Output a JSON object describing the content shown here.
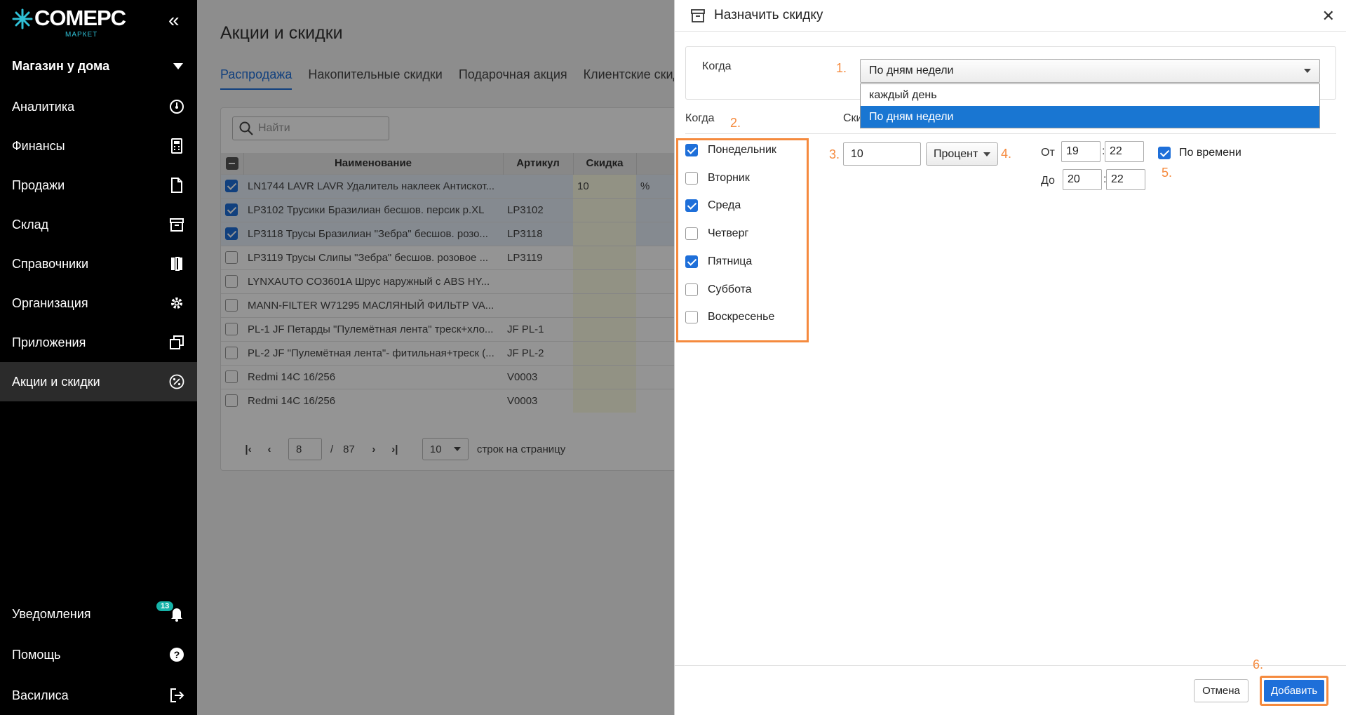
{
  "sidebar": {
    "logo_text": "COMEPC",
    "logo_sub": "МАРКЕТ",
    "store": "Магазин у дома",
    "items": [
      {
        "label": "Аналитика",
        "icon": "gauge-icon"
      },
      {
        "label": "Финансы",
        "icon": "calculator-icon"
      },
      {
        "label": "Продажи",
        "icon": "document-icon"
      },
      {
        "label": "Склад",
        "icon": "box-icon"
      },
      {
        "label": "Справочники",
        "icon": "books-icon"
      },
      {
        "label": "Организация",
        "icon": "gear-icon"
      },
      {
        "label": "Приложения",
        "icon": "windows-icon"
      },
      {
        "label": "Акции и скидки",
        "icon": "percent-icon"
      }
    ],
    "bottom": [
      {
        "label": "Уведомления",
        "icon": "bell-icon"
      },
      {
        "label": "Помощь",
        "icon": "help-icon"
      },
      {
        "label": "Василиса",
        "icon": "logout-icon"
      }
    ],
    "badge": "13"
  },
  "main": {
    "title": "Акции и скидки",
    "tabs": [
      "Распродажа",
      "Накопительные скидки",
      "Подарочная акция",
      "Клиентские скидки"
    ],
    "search_placeholder": "Найти",
    "columns": [
      "Наименование",
      "Артикул",
      "Скидка"
    ],
    "rows": [
      {
        "name": "LN1744 LAVR LAVR Удалитель наклеек Антискот...",
        "sku": "",
        "discount": "10",
        "unit": "%",
        "checked": true
      },
      {
        "name": "LP3102 Трусики Бразилиан бесшов. персик р.XL",
        "sku": "LP3102",
        "discount": "",
        "unit": "",
        "checked": true
      },
      {
        "name": "LP3118 Трусы Бразилиан \"Зебра\" бесшов. розо...",
        "sku": "LP3118",
        "discount": "",
        "unit": "",
        "checked": true
      },
      {
        "name": "LP3119 Трусы Слипы \"Зебра\" бесшов. розовое ...",
        "sku": "LP3119",
        "discount": "",
        "unit": "",
        "checked": false
      },
      {
        "name": "LYNXAUTO CO3601A Шрус наружный с ABS HY...",
        "sku": "",
        "discount": "",
        "unit": "",
        "checked": false
      },
      {
        "name": "MANN-FILTER W71295 МАСЛЯНЫЙ ФИЛЬТР VA...",
        "sku": "",
        "discount": "",
        "unit": "",
        "checked": false
      },
      {
        "name": "PL-1 JF Петарды \"Пулемётная лента\" треск+хло...",
        "sku": "JF PL-1",
        "discount": "",
        "unit": "",
        "checked": false
      },
      {
        "name": "PL-2 JF \"Пулемётная лента\"- фитильная+треск (...",
        "sku": "JF PL-2",
        "discount": "",
        "unit": "",
        "checked": false
      },
      {
        "name": "Redmi 14C 16/256",
        "sku": "V0003",
        "discount": "",
        "unit": "",
        "checked": false
      },
      {
        "name": "Redmi 14C 16/256",
        "sku": "V0003",
        "discount": "",
        "unit": "",
        "checked": false
      }
    ],
    "pager": {
      "page": "8",
      "sep": "/",
      "total": "87",
      "per_page": "10",
      "per_page_label": "строк на страницу"
    }
  },
  "modal": {
    "title": "Назначить скидку",
    "when_label": "Когда",
    "when_value": "По дням недели",
    "options": [
      "каждый день",
      "По дням недели"
    ],
    "col_when": "Когда",
    "col_discount": "Ски",
    "days": [
      {
        "label": "Понедельник",
        "checked": true
      },
      {
        "label": "Вторник",
        "checked": false
      },
      {
        "label": "Среда",
        "checked": true
      },
      {
        "label": "Четверг",
        "checked": false
      },
      {
        "label": "Пятница",
        "checked": true
      },
      {
        "label": "Суббота",
        "checked": false
      },
      {
        "label": "Воскресенье",
        "checked": false
      }
    ],
    "discount_value": "10",
    "discount_type": "Процент",
    "from_label": "От",
    "to_label": "До",
    "from_h": "19",
    "from_m": "22",
    "to_h": "20",
    "to_m": "22",
    "by_time_label": "По времени",
    "by_time_checked": true,
    "cancel": "Отмена",
    "add": "Добавить",
    "steps": [
      "1.",
      "2.",
      "3.",
      "4.",
      "5.",
      "6."
    ]
  },
  "colors": {
    "accent": "#1e6fd9",
    "annotation": "#f58a3e",
    "badge": "#16b3a8"
  }
}
